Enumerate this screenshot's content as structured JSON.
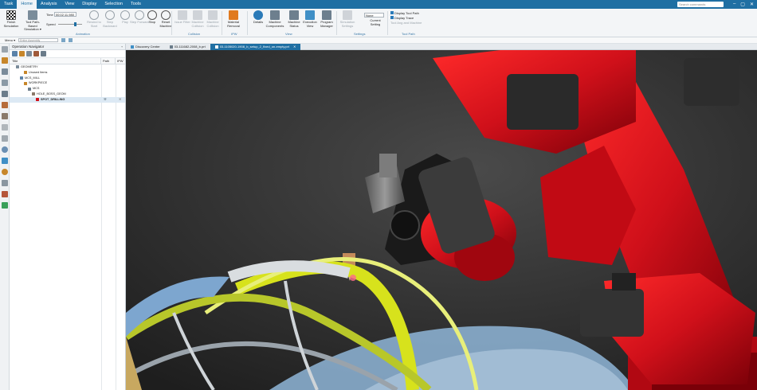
{
  "menubar": {
    "items": [
      "Task",
      "Home",
      "Analysis",
      "View",
      "Display",
      "Selection",
      "Tools"
    ],
    "active_index": 1,
    "search_placeholder": "Search commands"
  },
  "ribbon": {
    "finish": "Finish Simulation",
    "toolpath": "Tool Path-Based Simulation ▾",
    "time_label": "Time",
    "time_value": "00:02:11.980",
    "speed_label": "Speed",
    "anim_buttons": [
      "Rewind to Start",
      "Step Backward",
      "Play",
      "Step Forward",
      "Stop",
      "Reset Machine"
    ],
    "group_animation": "Animation",
    "collision_buttons": [
      "Issue Filter",
      "Machine Collision",
      "Machine Collision"
    ],
    "group_collision": "Collision",
    "material_removal": "Material Removal",
    "group_ipw": "IPW",
    "view_buttons": [
      "Details",
      "Machine Components",
      "Machine Status",
      "Execution View",
      "Program Manager"
    ],
    "group_view": "View",
    "settings_buttons": [
      "Simulation Settings",
      "Current Setting"
    ],
    "settings_value": "None",
    "group_settings": "Settings",
    "toolpath_buttons": [
      "Display Tool Path",
      "Display",
      "Trace",
      "Tool Ang and Machine"
    ],
    "group_toolpath": "Tool Path"
  },
  "quickbar": {
    "menu": "Menu ▾",
    "filter_placeholder": "Entire Assembly"
  },
  "navigator": {
    "title": "Operation Navigator",
    "columns": [
      "Title",
      "Path",
      "IPW"
    ],
    "rows": [
      {
        "label": "GEOMETRY",
        "indent": 1
      },
      {
        "label": "Unused Items",
        "indent": 3
      },
      {
        "label": "MCS_MILL",
        "indent": 2
      },
      {
        "label": "WORKPIECE",
        "indent": 3
      },
      {
        "label": "MCS",
        "indent": 4
      },
      {
        "label": "HOLE_BOSS_GEOM",
        "indent": 5
      },
      {
        "label": "SPOT_DRILLING",
        "indent": 6,
        "selected": true
      }
    ]
  },
  "tabs": [
    {
      "label": "Discovery Center",
      "active": false
    },
    {
      "label": "03-111682-2008_b.prt",
      "active": false
    },
    {
      "label": "03-1105020-1908_b_setup_2_fixed_on-empty.prt",
      "active": true
    }
  ],
  "colors": {
    "menubar": "#1f6fa3",
    "robot": "#d0101a",
    "wing_yellow": "#d7e21c",
    "wing_blue": "#8fb6d8",
    "background": "#2c2c2c"
  }
}
